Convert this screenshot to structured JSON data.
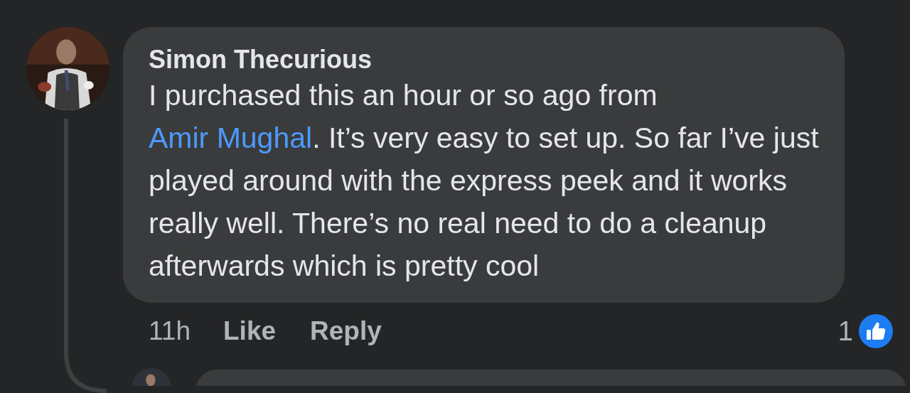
{
  "comment": {
    "author": "Simon Thecurious",
    "segments": [
      {
        "kind": "text",
        "text": "I purchased this an hour or so ago from "
      },
      {
        "kind": "link",
        "text": "Amir Mughal"
      },
      {
        "kind": "text",
        "text": ". It’s very easy to set up. So far I’ve just played around with the express peek and it works really well. There’s no real need to do a cleanup afterwards which is pretty cool"
      }
    ],
    "time": "11h",
    "actions": [
      "Like",
      "Reply"
    ],
    "reaction_count": "1"
  }
}
